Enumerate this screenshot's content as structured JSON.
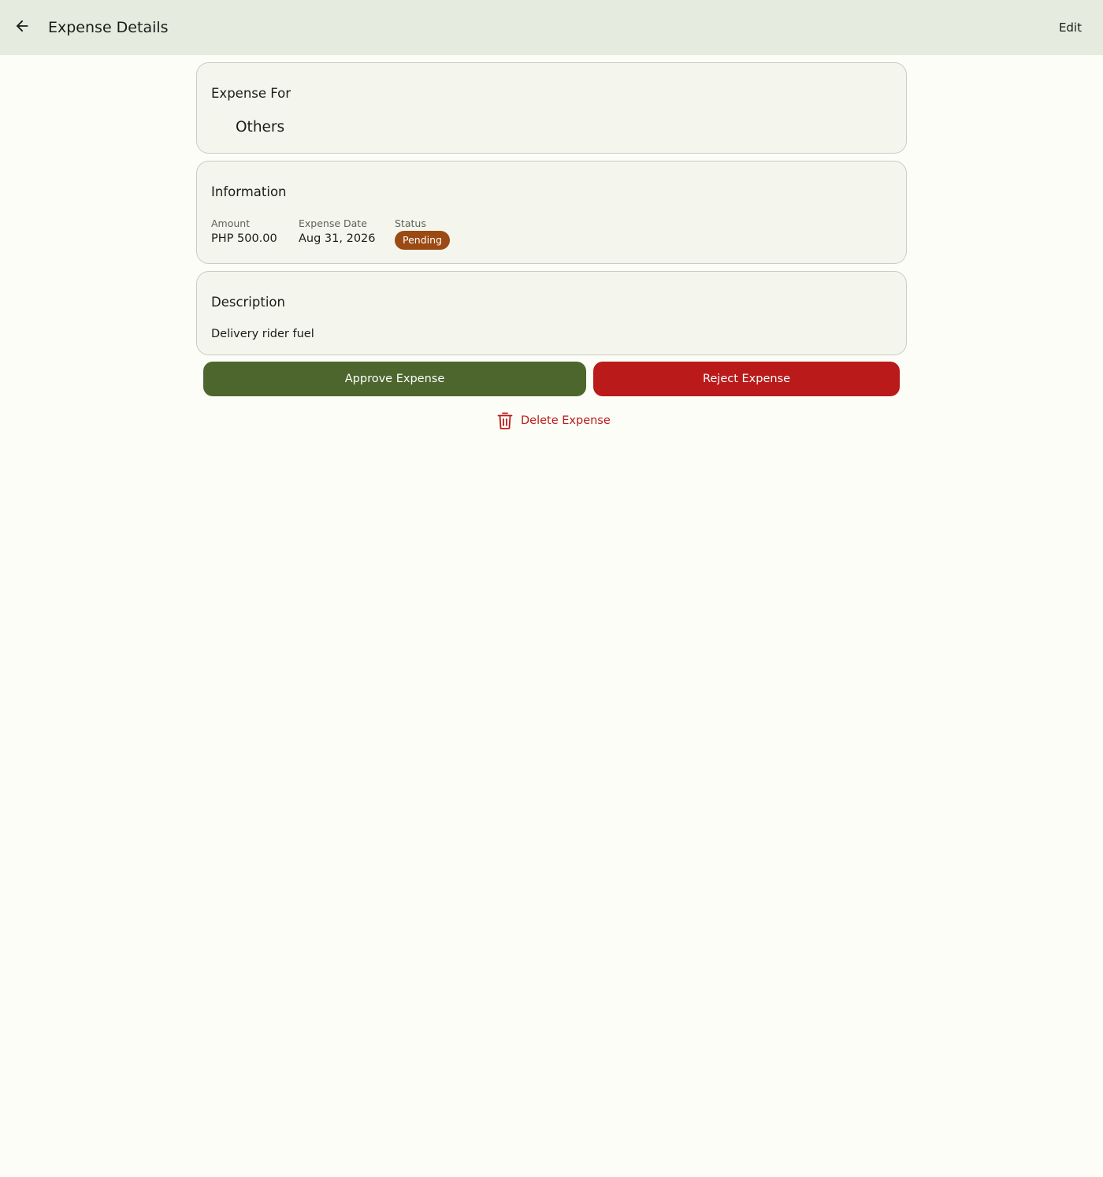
{
  "header": {
    "title": "Expense Details",
    "edit_label": "Edit",
    "back_icon": "arrow-back-icon"
  },
  "expense_for": {
    "heading": "Expense For",
    "value": "Others"
  },
  "information": {
    "heading": "Information",
    "amount_label": "Amount",
    "amount_value": "PHP 500.00",
    "date_label": "Expense Date",
    "date_value": "Aug 31, 2026",
    "status_label": "Status",
    "status_value": "Pending",
    "status_color": "#9a4a12"
  },
  "description": {
    "heading": "Description",
    "text": "Delivery rider fuel"
  },
  "actions": {
    "approve_label": "Approve Expense",
    "approve_color": "#4d662e",
    "reject_label": "Reject Expense",
    "reject_color": "#ba1a1a",
    "delete_label": "Delete Expense",
    "delete_icon": "trash-icon"
  }
}
